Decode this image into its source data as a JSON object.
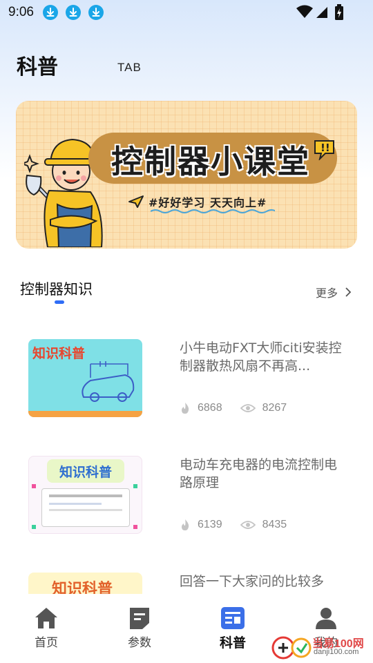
{
  "status_bar": {
    "time": "9:06",
    "notification_icons": [
      "download-icon",
      "download-icon",
      "download-icon"
    ],
    "system_icons": [
      "wifi-icon",
      "signal-icon",
      "battery-charging-icon"
    ]
  },
  "header": {
    "title": "科普",
    "tab_label": "TAB"
  },
  "banner": {
    "title": "控制器小课堂",
    "subtitle": "#好好学习 天天向上#"
  },
  "section": {
    "title": "控制器知识",
    "more_label": "更多"
  },
  "articles": [
    {
      "title": "小牛电动FXT大师citi安装控制器散热风扇不再高...",
      "thumb_tag": "知识科普",
      "likes": "6868",
      "views": "8267"
    },
    {
      "title": "电动车充电器的电流控制电路原理",
      "thumb_tag": "知识科普",
      "likes": "6139",
      "views": "8435"
    },
    {
      "title": "回答一下大家问的比较多",
      "thumb_tag": "知识科普"
    }
  ],
  "bottom_nav": [
    {
      "label": "首页",
      "icon": "home-icon"
    },
    {
      "label": "参数",
      "icon": "document-icon"
    },
    {
      "label": "科普",
      "icon": "article-icon",
      "active": true
    },
    {
      "label": "我的",
      "icon": "person-icon"
    }
  ],
  "colors": {
    "accent": "#2f6df6",
    "banner_bg": "#fbe1b3",
    "banner_pill": "#c89244"
  },
  "watermark": {
    "brand": "当易100网",
    "domain": "danji100.com"
  }
}
